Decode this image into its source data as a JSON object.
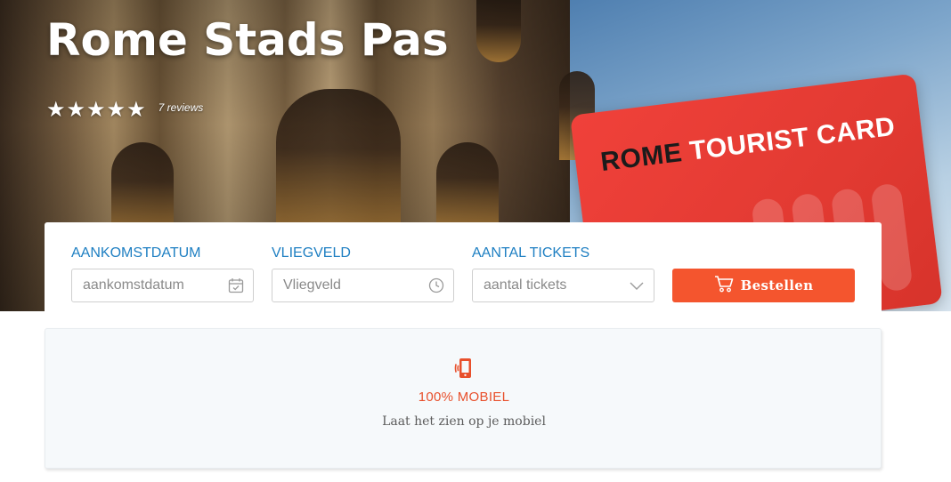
{
  "hero": {
    "title": "Rome Stads Pas",
    "rating_stars": 5,
    "reviews": "7 reviews",
    "card_text_dark": "ROME ",
    "card_text_light": "TOURIST CARD"
  },
  "booking": {
    "arrival_label": "AANKOMSTDATUM",
    "arrival_placeholder": "aankomstdatum",
    "airport_label": "VLIEGVELD",
    "airport_placeholder": "Vliegveld",
    "tickets_label": "AANTAL TICKETS",
    "tickets_placeholder": "aantal tickets",
    "order_label": "Bestellen"
  },
  "feature": {
    "title": "100% MOBIEL",
    "description": "Laat het zien op je mobiel"
  },
  "colors": {
    "accent": "#f4552e",
    "label_blue": "#1e7fc2",
    "feature_title": "#e8502c"
  },
  "icons": [
    "star-icon",
    "calendar-icon",
    "clock-icon",
    "chevron-down-icon",
    "cart-icon",
    "mobile-icon"
  ]
}
